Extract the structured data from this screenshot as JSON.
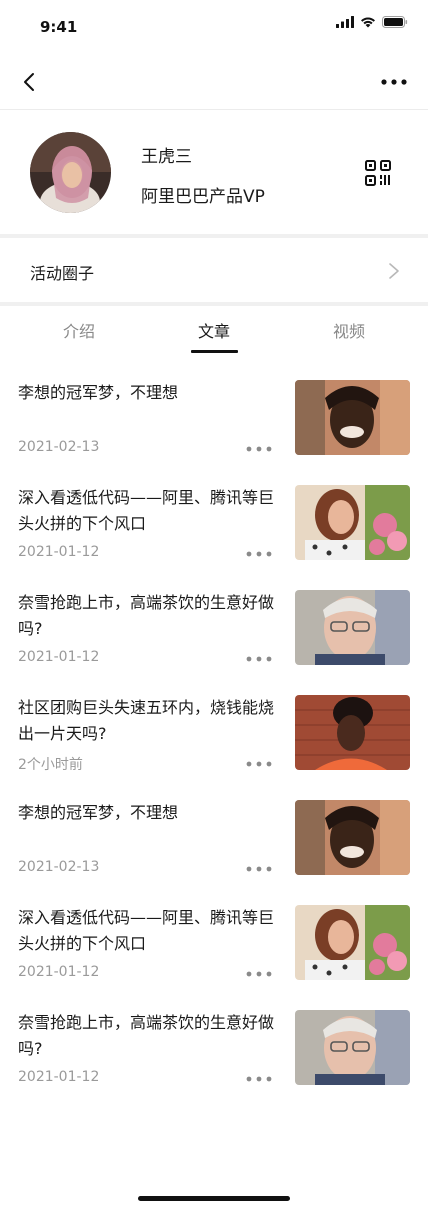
{
  "status_bar": {
    "time": "9:41"
  },
  "profile": {
    "name": "王虎三",
    "title": "阿里巴巴产品VP"
  },
  "activity_circle": {
    "label": "活动圈子"
  },
  "tabs": [
    {
      "label": "介绍"
    },
    {
      "label": "文章"
    },
    {
      "label": "视频"
    }
  ],
  "active_tab": "文章",
  "articles": [
    {
      "title": "李想的冠军梦，不理想",
      "date": "2021-02-13",
      "thumb": "man-smiling"
    },
    {
      "title": "深入看透低代码——阿里、腾讯等巨头火拼的下个风口",
      "date": "2021-01-12",
      "thumb": "woman-flowers"
    },
    {
      "title": "奈雪抢跑上市，高端茶饮的生意好做吗?",
      "date": "2021-01-12",
      "thumb": "older-man-glasses"
    },
    {
      "title": "社区团购巨头失速五环内，烧钱能烧出一片天吗?",
      "date": "2个小时前",
      "thumb": "woman-brick-wall"
    },
    {
      "title": "李想的冠军梦，不理想",
      "date": "2021-02-13",
      "thumb": "man-smiling"
    },
    {
      "title": "深入看透低代码——阿里、腾讯等巨头火拼的下个风口",
      "date": "2021-01-12",
      "thumb": "woman-flowers"
    },
    {
      "title": "奈雪抢跑上市，高端茶饮的生意好做吗?",
      "date": "2021-01-12",
      "thumb": "older-man-glasses"
    }
  ],
  "colors": {
    "text_primary": "#1a1a1a",
    "text_secondary": "#9a9a9a",
    "divider": "#f0f0f0",
    "accent": "#111111"
  }
}
